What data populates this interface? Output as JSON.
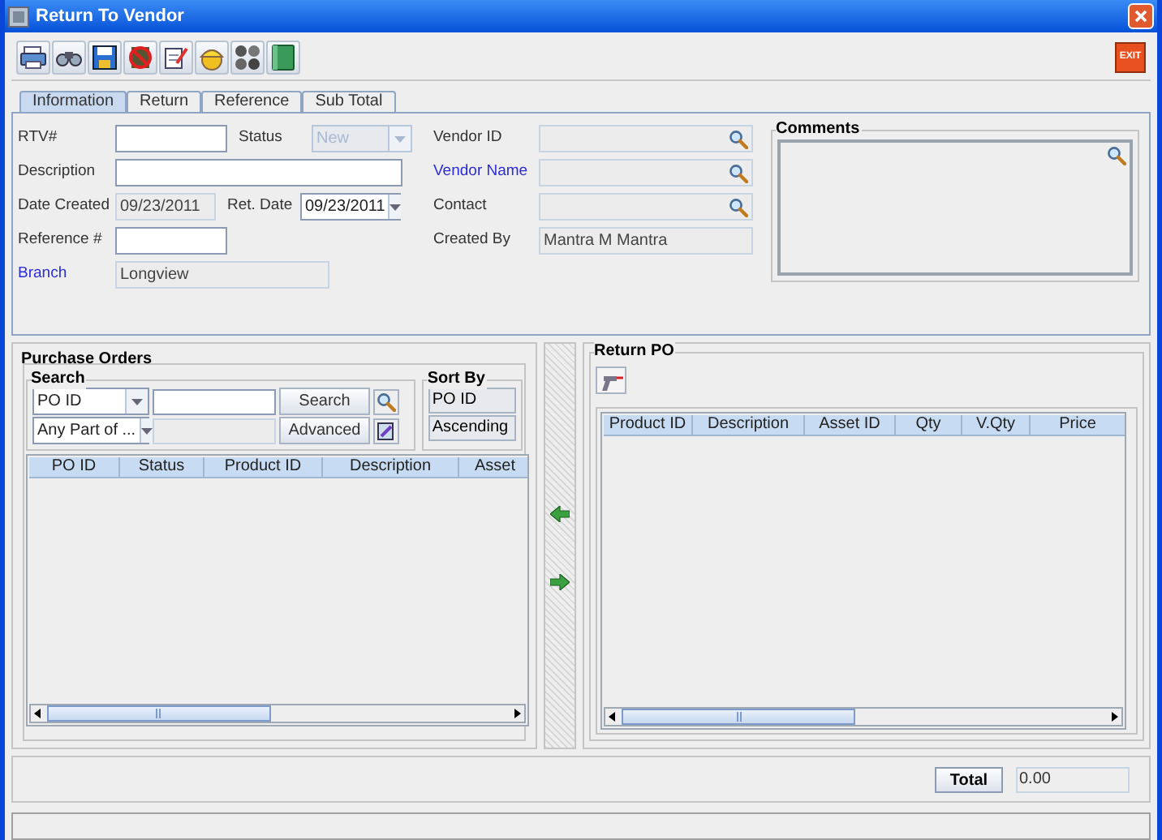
{
  "window": {
    "title": "Return To Vendor"
  },
  "exit_button": {
    "label": "EXIT"
  },
  "tabs": [
    {
      "label": "Information",
      "selected": true
    },
    {
      "label": "Return",
      "selected": false
    },
    {
      "label": "Reference",
      "selected": false
    },
    {
      "label": "Sub Total",
      "selected": false
    }
  ],
  "form_left": [
    {
      "label": "RTV#",
      "kind": "input",
      "link": false,
      "extra": {
        "label": "Status",
        "kind": "combo",
        "value": "New",
        "disabled": true
      }
    },
    {
      "label": "Description",
      "kind": "wide",
      "link": false
    },
    {
      "label": "Date Created",
      "kind": "display",
      "value": "09/23/2011",
      "link": false,
      "extra": {
        "label": "Ret. Date",
        "kind": "combo",
        "value": "09/23/2011",
        "disabled": false
      }
    },
    {
      "label": "Reference #",
      "kind": "input",
      "link": false
    },
    {
      "label": "Branch",
      "kind": "display_wide",
      "value": "Longview",
      "link": true
    }
  ],
  "form_right": [
    {
      "label": "Vendor ID",
      "kind": "lookup",
      "link": false
    },
    {
      "label": "Vendor Name",
      "kind": "lookup",
      "link": true
    },
    {
      "label": "Contact",
      "kind": "lookup",
      "link": false
    },
    {
      "label": "Created By",
      "kind": "display_wide",
      "value": "Mantra M Mantra",
      "link": false
    }
  ],
  "comments": {
    "title": "Comments"
  },
  "purchase_orders": {
    "title": "Purchase Orders",
    "search": {
      "title": "Search",
      "field_combo": "PO ID",
      "match_combo": "Any Part of ...",
      "search_button": "Search",
      "advanced_button": "Advanced"
    },
    "sort_by": {
      "title": "Sort By",
      "field": "PO ID",
      "order": "Ascending"
    },
    "columns": [
      "PO ID",
      "Status",
      "Product ID",
      "Description",
      "Asset"
    ]
  },
  "return_po": {
    "title": "Return PO",
    "columns": [
      "Product ID",
      "Description",
      "Asset ID",
      "Qty",
      "V.Qty",
      "Price"
    ]
  },
  "total": {
    "button": "Total",
    "value": "0.00"
  }
}
